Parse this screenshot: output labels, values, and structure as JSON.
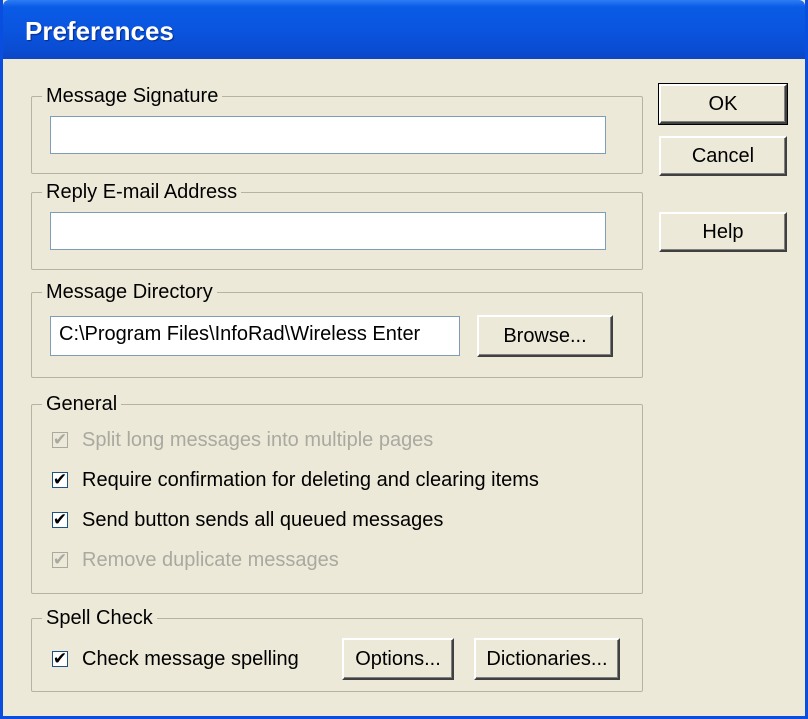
{
  "window": {
    "title": "Preferences"
  },
  "buttons": {
    "ok": "OK",
    "cancel": "Cancel",
    "help": "Help"
  },
  "message_signature": {
    "label": "Message Signature",
    "value": ""
  },
  "reply_email": {
    "label": "Reply E-mail Address",
    "value": ""
  },
  "message_directory": {
    "label": "Message Directory",
    "value": "C:\\Program Files\\InfoRad\\Wireless Enter",
    "browse_label": "Browse..."
  },
  "general": {
    "label": "General",
    "options": [
      {
        "label": "Split long messages into multiple pages",
        "checked": true,
        "enabled": false
      },
      {
        "label": "Require confirmation for deleting and clearing items",
        "checked": true,
        "enabled": true
      },
      {
        "label": "Send button sends all queued messages",
        "checked": true,
        "enabled": true
      },
      {
        "label": "Remove duplicate messages",
        "checked": true,
        "enabled": false
      }
    ]
  },
  "spell_check": {
    "label": "Spell Check",
    "check_label": "Check message spelling",
    "checked": true,
    "options_label": "Options...",
    "dictionaries_label": "Dictionaries..."
  },
  "glyphs": {
    "check": "✔"
  }
}
